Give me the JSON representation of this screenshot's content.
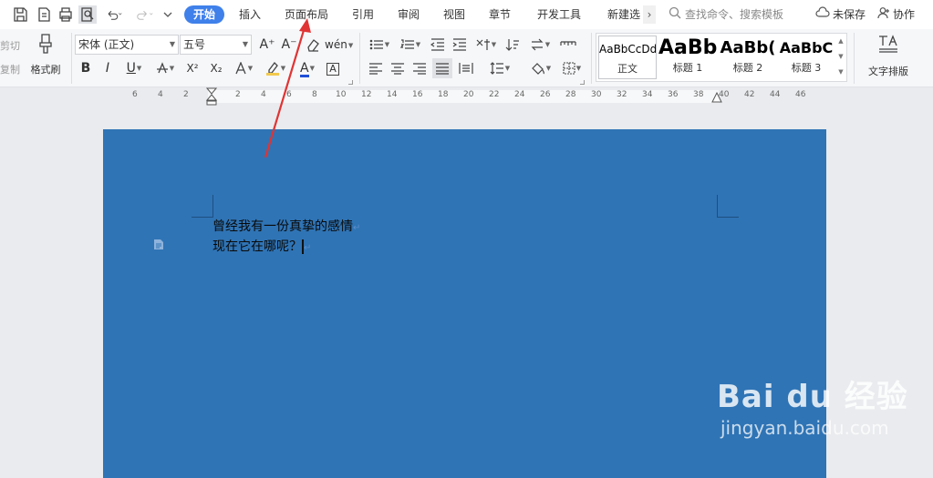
{
  "tabs": [
    {
      "label": "开始",
      "active": true
    },
    {
      "label": "插入"
    },
    {
      "label": "页面布局"
    },
    {
      "label": "引用"
    },
    {
      "label": "审阅"
    },
    {
      "label": "视图"
    },
    {
      "label": "章节"
    },
    {
      "label": "开发工具"
    },
    {
      "label": "新建选"
    }
  ],
  "header": {
    "more_tabs": "›",
    "search_placeholder": "查找命令、搜索模板",
    "save_status": "未保存",
    "collab_label": "协作"
  },
  "ribbon": {
    "cut_label": "剪切",
    "copy_label": "复制",
    "format_painter_label": "格式刷",
    "font_name": "宋体 (正文)",
    "font_size": "五号",
    "bold": "B",
    "italic": "I",
    "underline": "U",
    "superscript": "X²",
    "subscript": "X₂",
    "grow_font": "A⁺",
    "shrink_font": "A⁻",
    "phonetic": "wén",
    "char_border": "A",
    "font_color_letter": "A",
    "font_color_hex": "#1f4fd6",
    "highlight_color_hex": "#f2c94c",
    "styles": [
      {
        "preview": "AaBbCcDd",
        "label": "正文"
      },
      {
        "preview": "AaBb",
        "label": "标题 1"
      },
      {
        "preview": "AaBb(",
        "label": "标题 2"
      },
      {
        "preview": "AaBbC",
        "label": "标题 3"
      }
    ],
    "text_layout_label": "文字排版"
  },
  "ruler_numbers": [
    "6",
    "4",
    "2",
    "2",
    "4",
    "6",
    "8",
    "10",
    "12",
    "14",
    "16",
    "18",
    "20",
    "22",
    "24",
    "26",
    "28",
    "30",
    "32",
    "34",
    "36",
    "38",
    "40",
    "42",
    "44",
    "46"
  ],
  "document": {
    "page_color_hex": "#2f74b5",
    "lines": [
      "曾经我有一份真挚的感情",
      "现在它在哪呢？"
    ]
  },
  "annotation": {
    "arrow_color_hex": "#e03434"
  },
  "watermark": {
    "main": "Bai du 经验",
    "sub": "jingyan.baidu.com"
  }
}
